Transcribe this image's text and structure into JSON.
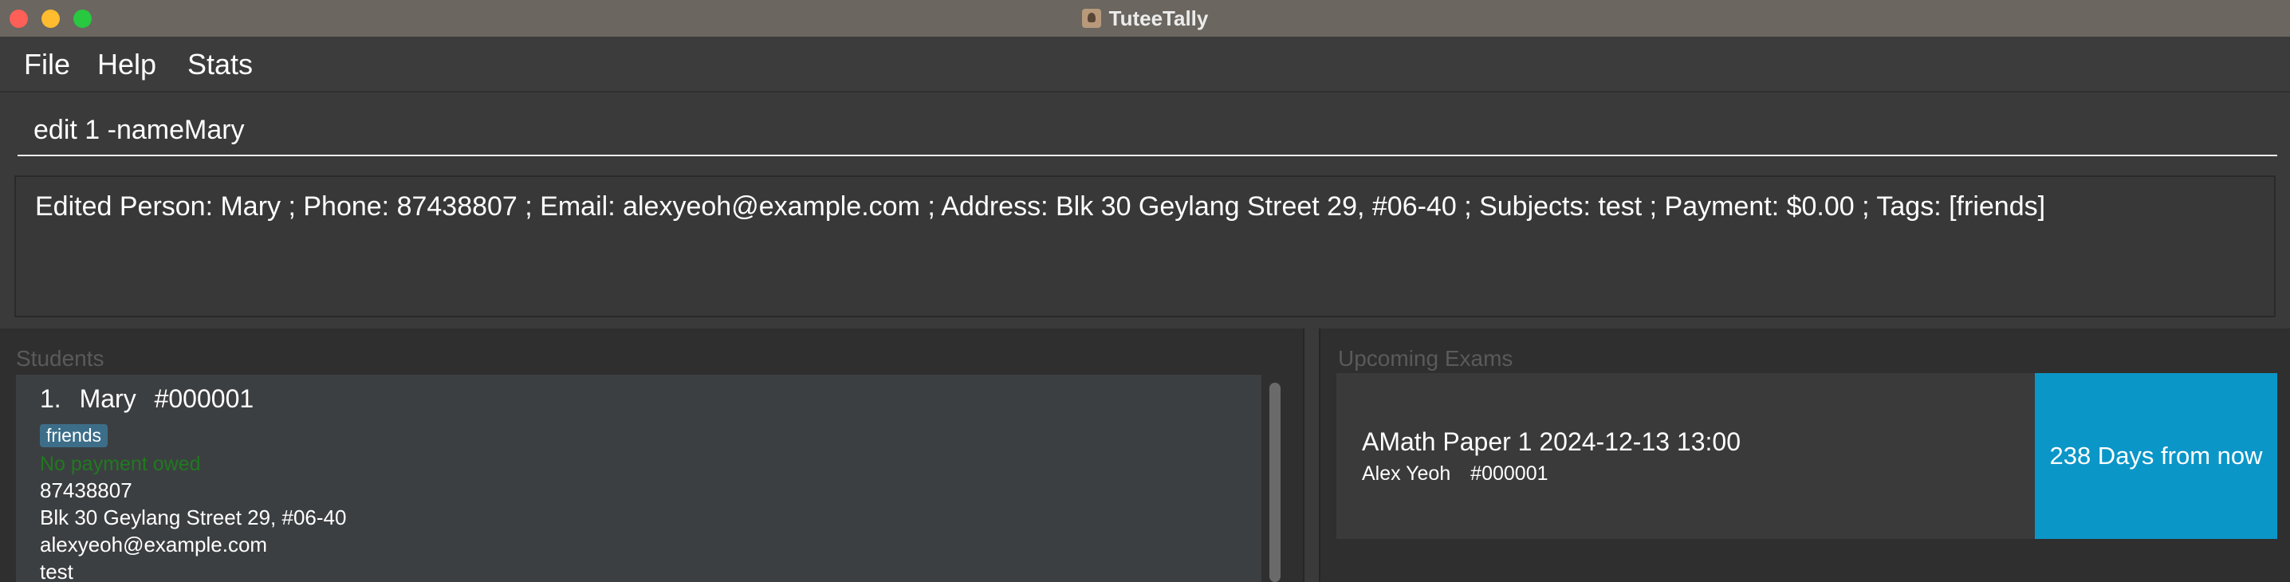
{
  "window": {
    "title": "TuteeTally",
    "controls": {
      "close": "close-icon",
      "minimize": "minimize-icon",
      "maximize": "maximize-icon"
    },
    "app_icon": "app-icon"
  },
  "menu": {
    "items": [
      {
        "label": "File"
      },
      {
        "label": "Help"
      },
      {
        "label": "Stats"
      }
    ]
  },
  "command": {
    "value": "edit 1 -nameMary"
  },
  "result": {
    "text": "Edited Person: Mary ; Phone: 87438807 ; Email: alexyeoh@example.com ; Address: Blk 30 Geylang Street 29, #06-40 ; Subjects: test ; Payment: $0.00 ; Tags: [friends]"
  },
  "students": {
    "title": "Students",
    "list": [
      {
        "index": "1.",
        "name": "Mary",
        "id": "#000001",
        "tags": [
          "friends"
        ],
        "payment_status": "No payment owed",
        "phone": "87438807",
        "address": "Blk 30 Geylang Street 29, #06-40",
        "email": "alexyeoh@example.com",
        "subjects": "test"
      }
    ]
  },
  "exams": {
    "title": "Upcoming Exams",
    "list": [
      {
        "name": "AMath Paper 1 2024-12-13 13:00",
        "student_name": "Alex Yeoh",
        "student_id": "#000001",
        "countdown": "238 Days from now"
      }
    ]
  },
  "colors": {
    "titlebar": "#6b6660",
    "background": "#3a3a3a",
    "panel": "#2f2f2f",
    "card": "#3c3f41",
    "tag": "#3d6e89",
    "payment_ok": "#1f7a1f",
    "countdown": "#0b96c8",
    "close": "#fe5f57",
    "minimize": "#febc2e",
    "maximize": "#28c840"
  }
}
